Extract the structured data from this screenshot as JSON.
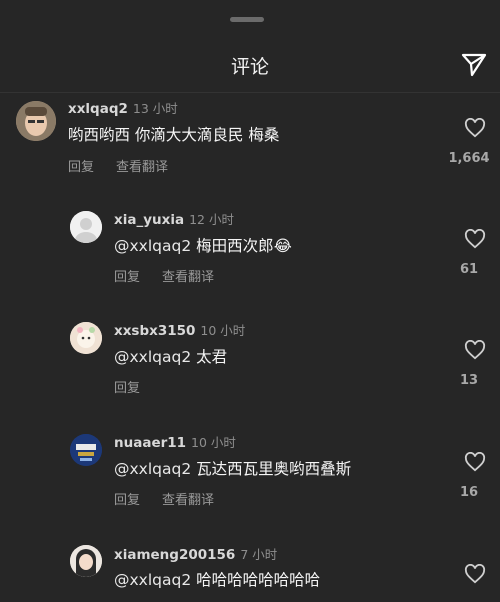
{
  "header": {
    "title": "评论",
    "send_icon": "paper-plane-icon"
  },
  "comments": [
    {
      "user": "xxlqaq2",
      "time": "13 小时",
      "mention": "",
      "text": "哟西哟西 你滴大大滴良民 梅桑",
      "reply_label": "回复",
      "translate_label": "查看翻译",
      "likes": "1,664"
    },
    {
      "user": "xia_yuxia",
      "time": "12 小时",
      "mention": "@xxlqaq2",
      "text": " 梅田西次郎😂",
      "reply_label": "回复",
      "translate_label": "查看翻译",
      "likes": "61"
    },
    {
      "user": "xxsbx3150",
      "time": "10 小时",
      "mention": "@xxlqaq2",
      "text": " 太君",
      "reply_label": "回复",
      "translate_label": "",
      "likes": "13"
    },
    {
      "user": "nuaaer11",
      "time": "10 小时",
      "mention": "@xxlqaq2",
      "text": " 瓦达西瓦里奥哟西叠斯",
      "reply_label": "回复",
      "translate_label": "查看翻译",
      "likes": "16"
    },
    {
      "user": "xiameng200156",
      "time": "7 小时",
      "mention": "@xxlqaq2",
      "text": " 哈哈哈哈哈哈哈哈",
      "reply_label": "",
      "translate_label": "",
      "likes": ""
    }
  ]
}
